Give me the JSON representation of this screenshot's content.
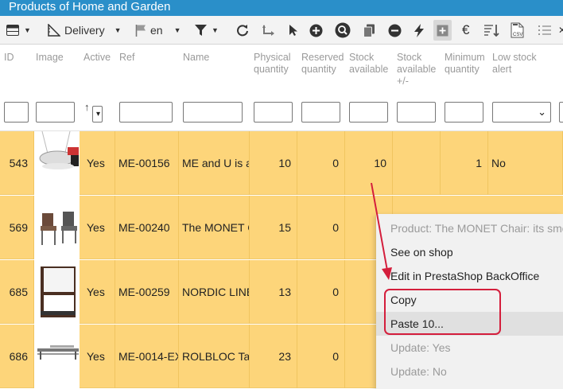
{
  "window": {
    "title": "Products of Home and Garden"
  },
  "toolbar": {
    "delivery_label": "Delivery",
    "lang_label": "en",
    "icons": [
      "grid-icon",
      "ruler-icon",
      "flag-icon",
      "filter-icon",
      "refresh-icon",
      "swap-icon",
      "cursor-icon",
      "plus-circle-icon",
      "reset-search-icon",
      "copy-icon",
      "minus-circle-icon",
      "lightning-icon",
      "add-box-icon",
      "euro-icon",
      "sort-icon",
      "csv-file-icon",
      "list-icon"
    ]
  },
  "columns": [
    {
      "key": "id",
      "label": "ID"
    },
    {
      "key": "image",
      "label": "Image"
    },
    {
      "key": "active",
      "label": "Active"
    },
    {
      "key": "ref",
      "label": "Ref"
    },
    {
      "key": "name",
      "label": "Name"
    },
    {
      "key": "phys",
      "label": "Physical quantity"
    },
    {
      "key": "reserved",
      "label": "Reserved quantity"
    },
    {
      "key": "stock",
      "label": "Stock available"
    },
    {
      "key": "stockpm",
      "label": "Stock available +/-"
    },
    {
      "key": "minq",
      "label": "Minimum quantity"
    },
    {
      "key": "lowstock",
      "label": "Low stock alert"
    }
  ],
  "rows": [
    {
      "id": "543",
      "active": "Yes",
      "ref": "ME-00156",
      "name": "ME and U is a",
      "phys": "10",
      "reserved": "0",
      "stock": "10",
      "stockpm": "",
      "minq": "1",
      "lowstock": "No"
    },
    {
      "id": "569",
      "active": "Yes",
      "ref": "ME-00240",
      "name": "The MONET C",
      "phys": "15",
      "reserved": "0",
      "stock": "",
      "stockpm": "",
      "minq": "",
      "lowstock": ""
    },
    {
      "id": "685",
      "active": "Yes",
      "ref": "ME-00259",
      "name": "NORDIC LINE",
      "phys": "13",
      "reserved": "0",
      "stock": "",
      "stockpm": "",
      "minq": "",
      "lowstock": ""
    },
    {
      "id": "686",
      "active": "Yes",
      "ref": "ME-0014-EX",
      "name": "ROLBLOC Ta",
      "phys": "23",
      "reserved": "0",
      "stock": "",
      "stockpm": "",
      "minq": "",
      "lowstock": ""
    }
  ],
  "context_menu": {
    "items": [
      {
        "label": "Product: The MONET Chair: its smo",
        "disabled": true
      },
      {
        "label": "See on shop",
        "disabled": false
      },
      {
        "label": "Edit in PrestaShop BackOffice",
        "disabled": false
      },
      {
        "label": "Copy",
        "disabled": false
      },
      {
        "label": "Paste 10...",
        "disabled": false
      },
      {
        "label": "Update: Yes",
        "disabled": true
      },
      {
        "label": "Update: No",
        "disabled": true
      }
    ]
  },
  "colors": {
    "titlebar": "#2a8fc9",
    "row_highlight": "#fdd57a",
    "annotation": "#d41e3c"
  }
}
